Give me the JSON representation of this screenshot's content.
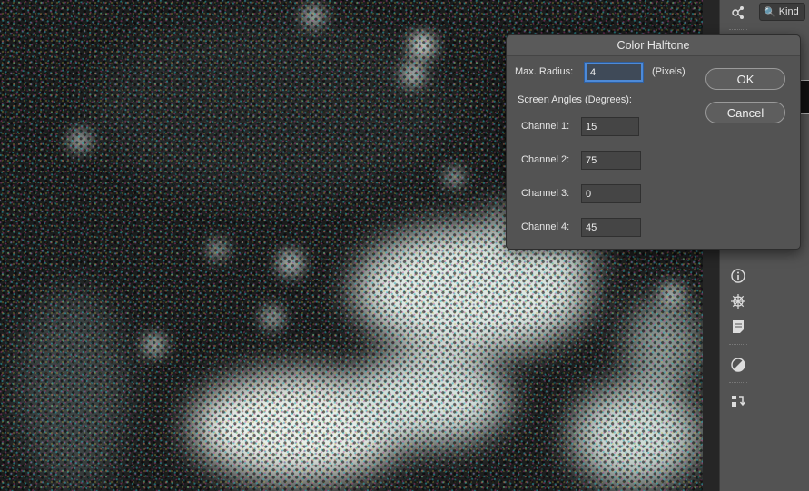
{
  "dialog": {
    "title": "Color Halftone",
    "max_radius": {
      "label": "Max. Radius:",
      "value": "4",
      "unit": "(Pixels)"
    },
    "screen_angles_label": "Screen Angles (Degrees):",
    "channels": [
      {
        "label": "Channel 1:",
        "value": "15"
      },
      {
        "label": "Channel 2:",
        "value": "75"
      },
      {
        "label": "Channel 3:",
        "value": "0"
      },
      {
        "label": "Channel 4:",
        "value": "45"
      }
    ],
    "ok_label": "OK",
    "cancel_label": "Cancel"
  },
  "layers_panel": {
    "filter_label": "Kind"
  },
  "tools": [
    {
      "name": "properties-icon"
    },
    {
      "name": "info-icon"
    },
    {
      "name": "navigator-icon"
    },
    {
      "name": "notes-icon"
    },
    {
      "name": "adjustments-icon"
    },
    {
      "name": "channels-icon"
    }
  ],
  "colors": {
    "panel": "#535353",
    "dialog_bg": "#535353",
    "focus_ring": "#4d8ad8",
    "canvas": "#0d0d0d"
  }
}
